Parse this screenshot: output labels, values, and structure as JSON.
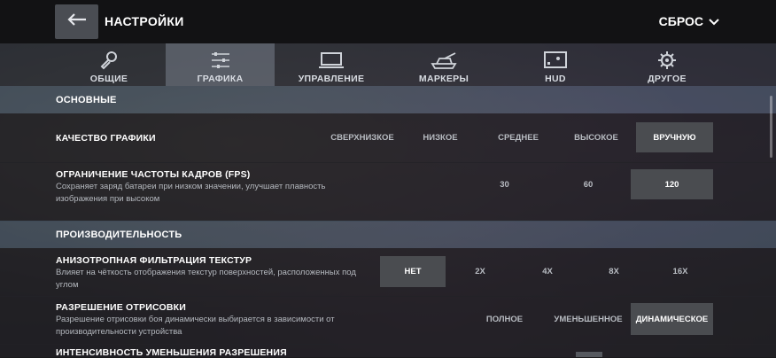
{
  "header": {
    "title": "НАСТРОЙКИ",
    "reset_label": "СБРОС"
  },
  "tabs": [
    {
      "label": "ОБЩИЕ",
      "icon": "wrench-icon"
    },
    {
      "label": "ГРАФИКА",
      "icon": "sliders-icon",
      "active": true
    },
    {
      "label": "УПРАВЛЕНИЕ",
      "icon": "monitor-icon"
    },
    {
      "label": "МАРКЕРЫ",
      "icon": "tank-icon"
    },
    {
      "label": "HUD",
      "icon": "hud-icon"
    },
    {
      "label": "ДРУГОЕ",
      "icon": "gear-icon"
    }
  ],
  "sections": {
    "basic": "ОСНОВНЫЕ",
    "performance": "ПРОИЗВОДИТЕЛЬНОСТЬ"
  },
  "quality": {
    "label": "КАЧЕСТВО ГРАФИКИ",
    "options": [
      "СВЕРХНИЗКОЕ",
      "НИЗКОЕ",
      "СРЕДНЕЕ",
      "ВЫСОКОЕ",
      "ВРУЧНУЮ"
    ],
    "selected": "ВРУЧНУЮ"
  },
  "fps": {
    "label": "ОГРАНИЧЕНИЕ ЧАСТОТЫ КАДРОВ (FPS)",
    "desc": "Сохраняет заряд батареи при низком значении, улучшает плавность изображения при высоком",
    "options": [
      "30",
      "60",
      "120"
    ],
    "selected": "120"
  },
  "aniso": {
    "label": "АНИЗОТРОПНАЯ ФИЛЬТРАЦИЯ ТЕКСТУР",
    "desc": "Влияет на чёткость отображения текстур поверхностей, расположенных под углом",
    "options": [
      "НЕТ",
      "2X",
      "4X",
      "8X",
      "16X"
    ],
    "selected": "НЕТ"
  },
  "resolution": {
    "label": "РАЗРЕШЕНИЕ ОТРИСОВКИ",
    "desc": "Разрешение отрисовки боя динамически выбирается в зависимости от производительности устройства",
    "options": [
      "ПОЛНОЕ",
      "УМЕНЬШЕННОЕ",
      "ДИНАМИЧЕСКОЕ"
    ],
    "selected": "ДИНАМИЧЕСКОЕ"
  },
  "intensity": {
    "label": "ИНТЕНСИВНОСТЬ УМЕНЬШЕНИЯ РАЗРЕШЕНИЯ"
  }
}
